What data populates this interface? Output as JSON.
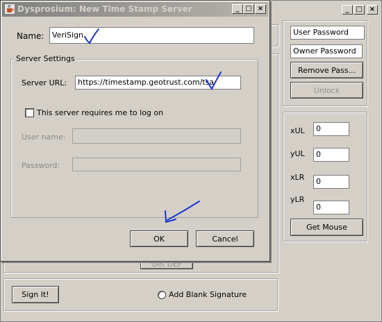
{
  "parent_window": {
    "buttons": {
      "minimize": "_",
      "maximize": "□",
      "close": "×"
    },
    "right_panel": {
      "user_password_value": "User Password",
      "owner_password_value": "Owner Password",
      "remove_pass_label": "Remove Pass...",
      "unlock_label": "Unlock"
    },
    "coords_panel": {
      "xul_label": "xUL",
      "xul_value": "0",
      "yul_label": "yUL",
      "yul_value": "0",
      "xlr_label": "xLR",
      "xlr_value": "0",
      "ylr_label": "yLR",
      "ylr_value": "0",
      "get_mouse_label": "Get Mouse"
    },
    "hidden_button_label": "Get DEF",
    "bottom_panel": {
      "sign_it_label": "Sign It!",
      "add_blank_label": "Add Blank Signature"
    }
  },
  "dialog": {
    "title": "Dysprosium: New Time Stamp Server",
    "buttons": {
      "minimize": "_",
      "maximize": "□",
      "close": "×"
    },
    "name_label": "Name:",
    "name_value": "VeriSign",
    "server_settings_legend": "Server Settings",
    "server_url_label": "Server URL:",
    "server_url_value": "https://timestamp.geotrust.com/tsa",
    "logon_checkbox_label": "This server requires me to log on",
    "username_label": "User name:",
    "username_value": "",
    "password_label": "Password:",
    "password_value": "",
    "ok_label": "OK",
    "cancel_label": "Cancel"
  },
  "colors": {
    "window_bg": "#d4d0c8",
    "ink": "#1a33cc",
    "titlebar_inactive": "#808080"
  }
}
